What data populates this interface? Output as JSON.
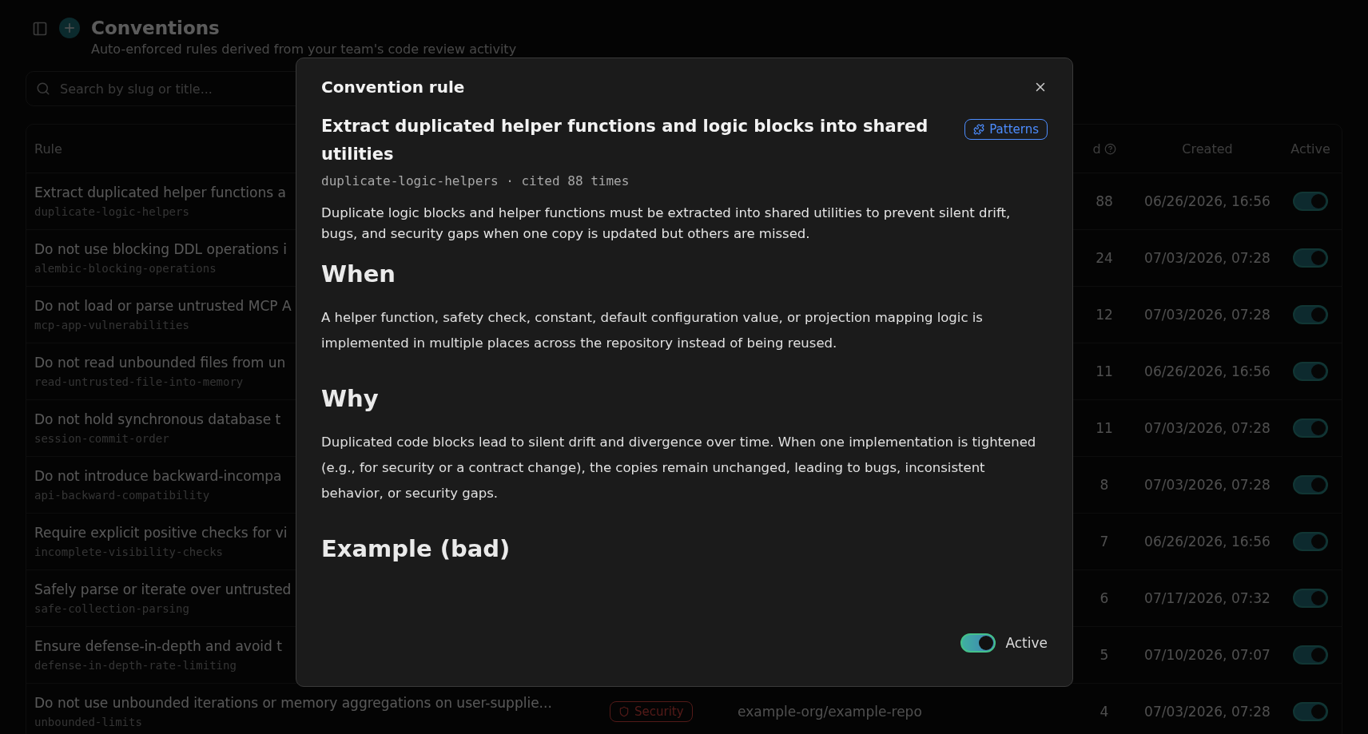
{
  "page": {
    "title": "Conventions",
    "subtitle": "Auto-enforced rules derived from your team's code review activity",
    "search": {
      "placeholder": "Search by slug or title..."
    }
  },
  "table": {
    "columns": {
      "rule": "Rule",
      "cited": "d",
      "created": "Created",
      "active": "Active"
    },
    "rows": [
      {
        "title": "Extract duplicated helper functions a",
        "slug": "duplicate-logic-helpers",
        "cited": "88",
        "created": "06/26/2026, 16:56",
        "active": true
      },
      {
        "title": "Do not use blocking DDL operations i",
        "slug": "alembic-blocking-operations",
        "cited": "24",
        "created": "07/03/2026, 07:28",
        "active": true
      },
      {
        "title": "Do not load or parse untrusted MCP A",
        "slug": "mcp-app-vulnerabilities",
        "cited": "12",
        "created": "07/03/2026, 07:28",
        "active": true
      },
      {
        "title": "Do not read unbounded files from un",
        "slug": "read-untrusted-file-into-memory",
        "cited": "11",
        "created": "06/26/2026, 16:56",
        "active": true
      },
      {
        "title": "Do not hold synchronous database t",
        "slug": "session-commit-order",
        "cited": "11",
        "created": "07/03/2026, 07:28",
        "active": true
      },
      {
        "title": "Do not introduce backward-incompa",
        "slug": "api-backward-compatibility",
        "cited": "8",
        "created": "07/03/2026, 07:28",
        "active": true
      },
      {
        "title": "Require explicit positive checks for vi",
        "slug": "incomplete-visibility-checks",
        "cited": "7",
        "created": "06/26/2026, 16:56",
        "active": true
      },
      {
        "title": "Safely parse or iterate over untrusted",
        "slug": "safe-collection-parsing",
        "cited": "6",
        "created": "07/17/2026, 07:32",
        "active": true
      },
      {
        "title": "Ensure defense-in-depth and avoid t",
        "slug": "defense-in-depth-rate-limiting",
        "cited": "5",
        "created": "07/10/2026, 07:07",
        "active": true
      },
      {
        "title": "Do not use unbounded iterations or memory aggregations on user-supplie...",
        "slug": "unbounded-limits",
        "category": {
          "label": "Security",
          "kind": "security"
        },
        "repo": "example-org/example-repo",
        "cited": "4",
        "created": "07/03/2026, 07:28",
        "active": true
      }
    ]
  },
  "modal": {
    "title": "Convention rule",
    "heading": "Extract duplicated helper functions and logic blocks into shared utilities",
    "category": {
      "label": "Patterns",
      "kind": "patterns"
    },
    "meta": "duplicate-logic-helpers · cited 88 times",
    "description": "Duplicate logic blocks and helper functions must be extracted into shared utilities to prevent silent drift, bugs, and security gaps when one copy is updated but others are missed.",
    "sections": [
      {
        "heading": "When",
        "text": "A helper function, safety check, constant, default configuration value, or projection mapping logic is implemented in multiple places across the repository instead of being reused."
      },
      {
        "heading": "Why",
        "text": "Duplicated code blocks lead to silent drift and divergence over time. When one implementation is tightened (e.g., for security or a contract change), the copies remain unchanged, leading to bugs, inconsistent behavior, or security gaps."
      },
      {
        "heading": "Example (bad)"
      }
    ],
    "active": {
      "label": "Active",
      "on": true
    }
  }
}
